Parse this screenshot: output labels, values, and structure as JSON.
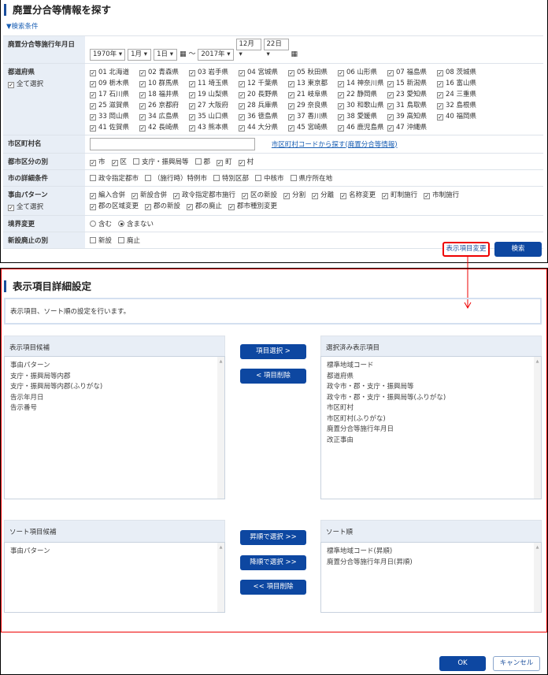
{
  "search": {
    "title": "廃置分合等情報を探す",
    "conditions_toggle": "▼検索条件",
    "date": {
      "label": "廃置分合等施行年月日",
      "from_year": "1970年",
      "from_month": "1月",
      "from_day": "1日",
      "separator": "〜",
      "to_year": "2017年",
      "to_month": "12月",
      "to_day": "22日"
    },
    "prefecture": {
      "label": "都道府県",
      "select_all": "全て選択",
      "select_all_checked": true,
      "items": [
        "01 北海道",
        "02 青森県",
        "03 岩手県",
        "04 宮城県",
        "05 秋田県",
        "06 山形県",
        "07 福島県",
        "08 茨城県",
        "09 栃木県",
        "10 群馬県",
        "11 埼玉県",
        "12 千葉県",
        "13 東京都",
        "14 神奈川県",
        "15 新潟県",
        "16 富山県",
        "17 石川県",
        "18 福井県",
        "19 山梨県",
        "20 長野県",
        "21 岐阜県",
        "22 静岡県",
        "23 愛知県",
        "24 三重県",
        "25 滋賀県",
        "26 京都府",
        "27 大阪府",
        "28 兵庫県",
        "29 奈良県",
        "30 和歌山県",
        "31 鳥取県",
        "32 島根県",
        "33 岡山県",
        "34 広島県",
        "35 山口県",
        "36 徳島県",
        "37 香川県",
        "38 愛媛県",
        "39 高知県",
        "40 福岡県",
        "41 佐賀県",
        "42 長崎県",
        "43 熊本県",
        "44 大分県",
        "45 宮崎県",
        "46 鹿児島県",
        "47 沖縄県"
      ]
    },
    "municipality": {
      "label": "市区町村名",
      "value": "",
      "link": "市区町村コードから探す(廃置分合等情報)"
    },
    "city_type": {
      "label": "都市区分の別",
      "options": [
        {
          "label": "市",
          "checked": true
        },
        {
          "label": "区",
          "checked": true
        },
        {
          "label": "支庁・振興局等",
          "checked": false
        },
        {
          "label": "郡",
          "checked": false
        },
        {
          "label": "町",
          "checked": true
        },
        {
          "label": "村",
          "checked": true
        }
      ]
    },
    "city_detail": {
      "label": "市の詳細条件",
      "options": [
        {
          "label": "政令指定都市",
          "checked": false
        },
        {
          "label": "（施行時）特例市",
          "checked": false
        },
        {
          "label": "特別区部",
          "checked": false
        },
        {
          "label": "中核市",
          "checked": false
        },
        {
          "label": "県庁所在地",
          "checked": false
        }
      ]
    },
    "reason": {
      "label": "事由パターン",
      "select_all": "全て選択",
      "select_all_checked": true,
      "options": [
        {
          "label": "編入合併",
          "checked": true
        },
        {
          "label": "新設合併",
          "checked": true
        },
        {
          "label": "政令指定都市施行",
          "checked": true
        },
        {
          "label": "区の新設",
          "checked": true
        },
        {
          "label": "分割",
          "checked": true
        },
        {
          "label": "分離",
          "checked": true
        },
        {
          "label": "名称変更",
          "checked": true
        },
        {
          "label": "町制施行",
          "checked": true
        },
        {
          "label": "市制施行",
          "checked": true
        },
        {
          "label": "郡の区域変更",
          "checked": true
        },
        {
          "label": "郡の新設",
          "checked": true
        },
        {
          "label": "郡の廃止",
          "checked": true
        },
        {
          "label": "郡市種別変更",
          "checked": true
        }
      ]
    },
    "boundary": {
      "label": "境界変更",
      "options": [
        {
          "label": "含む",
          "checked": false
        },
        {
          "label": "含まない",
          "checked": true
        }
      ]
    },
    "new_abolish": {
      "label": "新設廃止の別",
      "options": [
        {
          "label": "新設",
          "checked": false
        },
        {
          "label": "廃止",
          "checked": false
        }
      ]
    },
    "display_change_button": "表示項目変更",
    "search_button": "検索"
  },
  "detail": {
    "title": "表示項目詳細設定",
    "description": "表示項目、ソート順の設定を行います。",
    "candidates": {
      "header": "表示項目候補",
      "items": [
        "事由パターン",
        "支庁・振興局等内郡",
        "支庁・振興局等内郡(ふりがな)",
        "告示年月日",
        "告示番号"
      ]
    },
    "selected": {
      "header": "選択済み表示項目",
      "items": [
        "標準地域コード",
        "都道府県",
        "政令市・郡・支庁・振興局等",
        "政令市・郡・支庁・振興局等(ふりがな)",
        "市区町村",
        "市区町村(ふりがな)",
        "廃置分合等施行年月日",
        "改正事由"
      ]
    },
    "select_button": "項目選択 >",
    "remove_button": "< 項目削除",
    "sort_candidates": {
      "header": "ソート項目候補",
      "items": [
        "事由パターン"
      ]
    },
    "sort_order": {
      "header": "ソート順",
      "items": [
        "標準地域コード(昇順)",
        "廃置分合等施行年月日(昇順)"
      ]
    },
    "asc_button": "昇順で選択 >>",
    "desc_button": "降順で選択 >>",
    "sort_remove_button": "<< 項目削除",
    "ok_button": "OK",
    "cancel_button": "キャンセル"
  },
  "colors": {
    "accent": "#0d47a1",
    "label_bg": "#e8eef6",
    "annotation": "#e00000"
  }
}
